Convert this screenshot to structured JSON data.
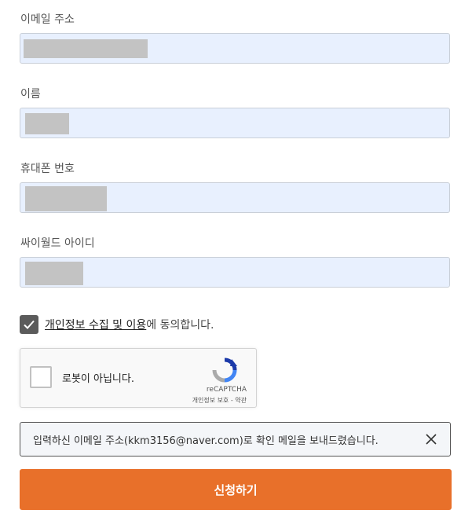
{
  "form": {
    "email_label": "이메일 주소",
    "name_label": "이름",
    "phone_label": "휴대폰 번호",
    "cyworld_id_label": "싸이월드 아이디"
  },
  "consent": {
    "checked": true,
    "link_text": "개인정보 수집 및 이용",
    "suffix_text": "에 동의합니다."
  },
  "recaptcha": {
    "label": "로봇이 아닙니다.",
    "brand": "reCAPTCHA",
    "links": "개인정보 보호 - 약관"
  },
  "notice": {
    "message": "입력하신 이메일 주소(kkm3156@naver.com)로 확인 메일을 보내드렸습니다."
  },
  "submit_label": "신청하기",
  "colors": {
    "accent": "#e8702a",
    "input_bg": "#e8f0fe"
  }
}
